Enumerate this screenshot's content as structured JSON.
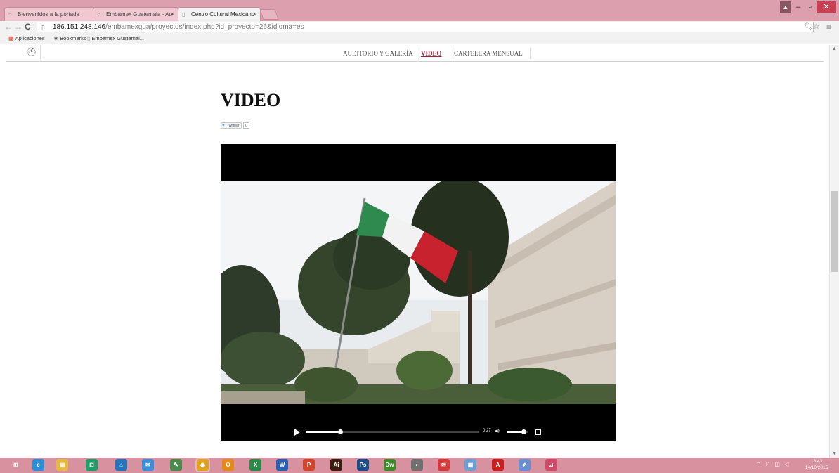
{
  "browser": {
    "tabs": [
      {
        "title": "Bienvenidos a la portada",
        "active": false
      },
      {
        "title": "Embamex Guatemala - Au",
        "active": false
      },
      {
        "title": "Centro Cultural Mexicano",
        "active": true
      }
    ],
    "address": {
      "host": "186.151.248.146",
      "path": "/embamexgua/proyectos/index.php?id_proyecto=26&idioma=es"
    },
    "bookmarks": [
      {
        "label": "Aplicaciones",
        "icon": "apps-grid-icon"
      },
      {
        "label": "Bookmarks",
        "icon": "star-icon"
      },
      {
        "label": "Embamex Guatemal...",
        "icon": "page-icon"
      }
    ],
    "tab_close_glyph": "×"
  },
  "site": {
    "nav": [
      {
        "label": "AUDITORIO Y GALERÍA",
        "active": false
      },
      {
        "label": "VIDEO",
        "active": true
      },
      {
        "label": "CARTELERA MENSUAL",
        "active": false
      }
    ],
    "title": "VIDEO",
    "tweet": {
      "label": "Twittear",
      "count": "0"
    }
  },
  "video": {
    "time": "0:27",
    "progress": 0.2,
    "volume": 0.75
  },
  "colors": {
    "window_frame": "#dc9fae",
    "taskbar": "#d7919f",
    "nav_active": "#9b2335",
    "close_button": "#c74152"
  },
  "taskbar": {
    "icons": [
      {
        "name": "start-icon",
        "label": "⊞",
        "color": "#d7919f"
      },
      {
        "name": "ie-icon",
        "label": "e",
        "color": "#2c8fd6"
      },
      {
        "name": "explorer-icon",
        "label": "▤",
        "color": "#e3b93e"
      },
      {
        "name": "store-icon",
        "label": "⊡",
        "color": "#1f9e6a"
      },
      {
        "name": "home-icon",
        "label": "⌂",
        "color": "#2573b8"
      },
      {
        "name": "mail-icon",
        "label": "✉",
        "color": "#3a8fd8"
      },
      {
        "name": "pen-icon",
        "label": "✎",
        "color": "#4a8a4a"
      },
      {
        "name": "chrome-icon",
        "label": "◉",
        "color": "#e0a223"
      },
      {
        "name": "outlook-icon",
        "label": "O",
        "color": "#e48a1a"
      },
      {
        "name": "excel-icon",
        "label": "X",
        "color": "#2a8a4a"
      },
      {
        "name": "word-icon",
        "label": "W",
        "color": "#2b5fb3"
      },
      {
        "name": "powerpoint-icon",
        "label": "P",
        "color": "#d0462b"
      },
      {
        "name": "illustrator-icon",
        "label": "Ai",
        "color": "#3a1d0c"
      },
      {
        "name": "photoshop-icon",
        "label": "Ps",
        "color": "#1c4f8a"
      },
      {
        "name": "dreamweaver-icon",
        "label": "Dw",
        "color": "#3f8a2a"
      },
      {
        "name": "disk-icon",
        "label": "◐",
        "color": "#707070"
      },
      {
        "name": "messenger-icon",
        "label": "✉",
        "color": "#d43a3a"
      },
      {
        "name": "calculator-icon",
        "label": "▦",
        "color": "#6aa0d8"
      },
      {
        "name": "acrobat-icon",
        "label": "A",
        "color": "#c8201f"
      },
      {
        "name": "paint-icon",
        "label": "✐",
        "color": "#6a8fd0"
      },
      {
        "name": "graph-icon",
        "label": "⊿",
        "color": "#d04a6a"
      }
    ],
    "tray": "⌃ ⚐ ◫ ◁",
    "clock_time": "18:43",
    "clock_date": "14/10/2015"
  }
}
